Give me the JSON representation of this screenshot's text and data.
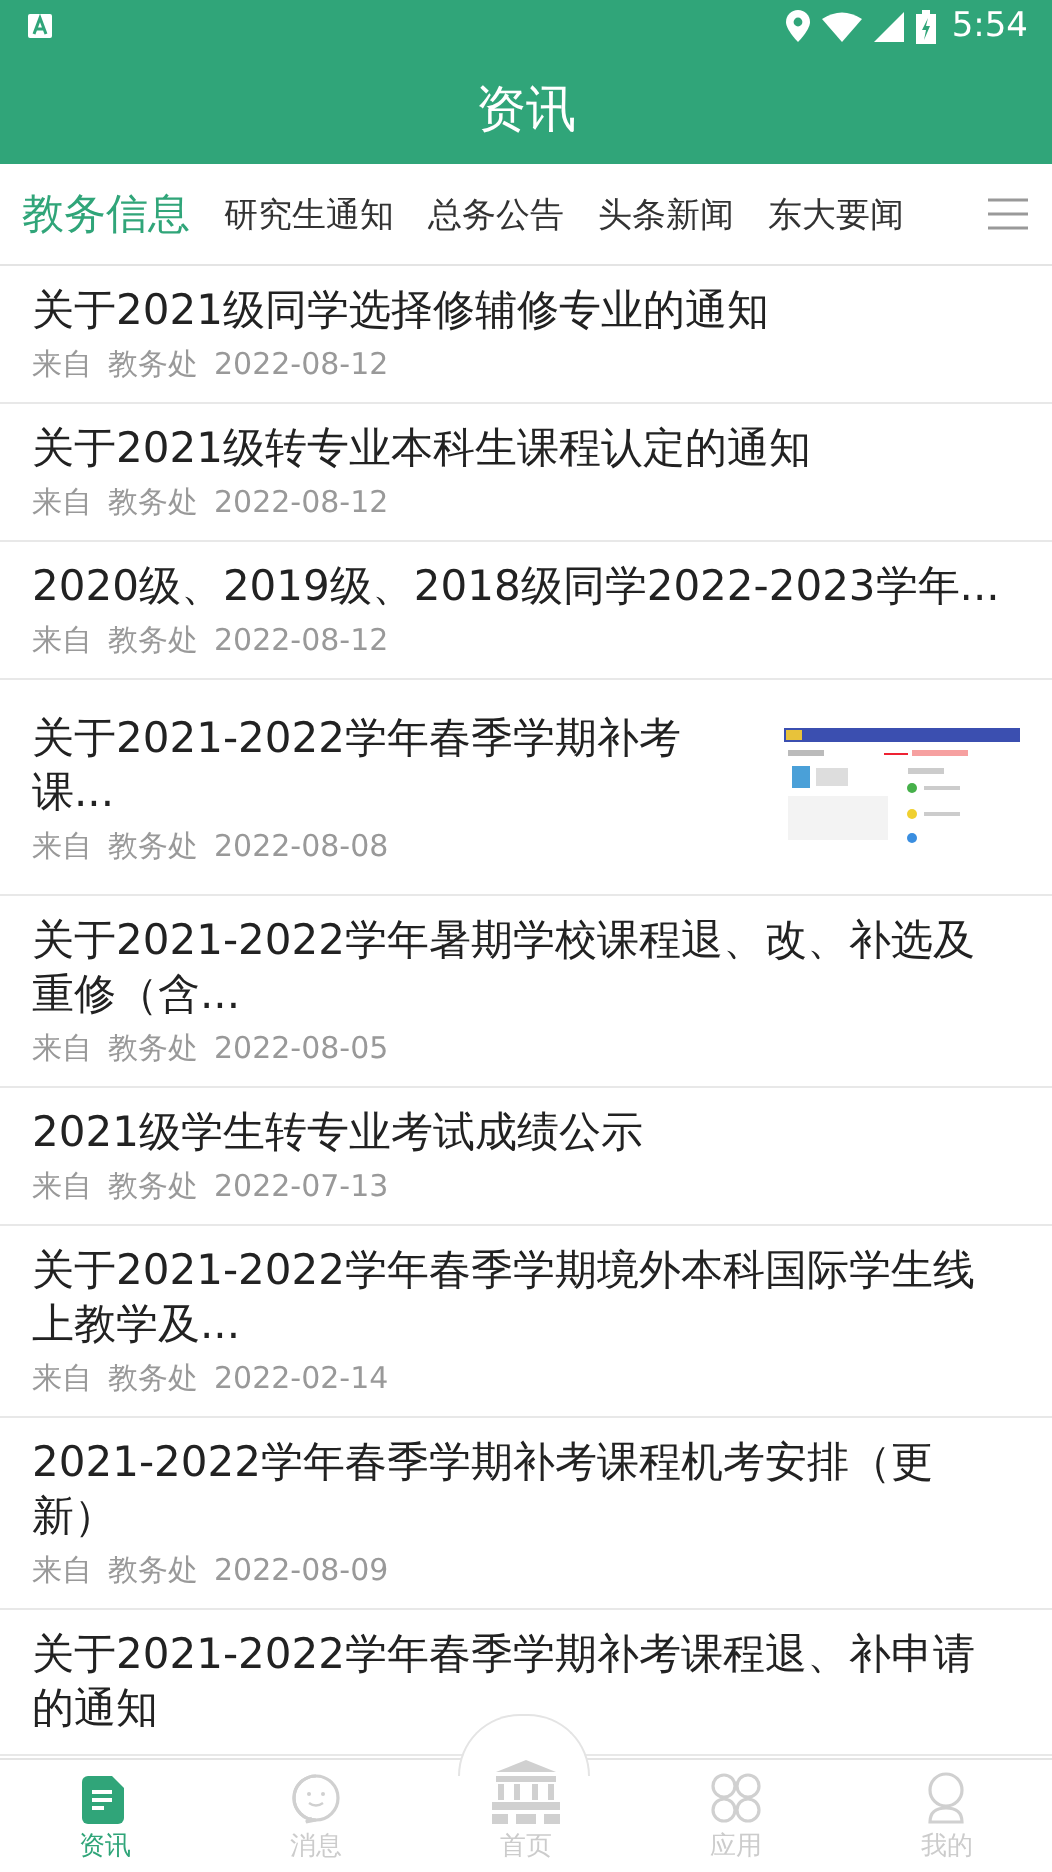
{
  "status_bar": {
    "time": "5:54"
  },
  "header": {
    "title": "资讯"
  },
  "tabs": [
    {
      "label": "教务信息",
      "selected": true
    },
    {
      "label": "研究生通知",
      "selected": false
    },
    {
      "label": "总务公告",
      "selected": false
    },
    {
      "label": "头条新闻",
      "selected": false
    },
    {
      "label": "东大要闻",
      "selected": false
    }
  ],
  "news": [
    {
      "title": "关于2021级同学选择修辅修专业的通知",
      "from_label": "来自",
      "source": "教务处",
      "date": "2022-08-12"
    },
    {
      "title": "关于2021级转专业本科生课程认定的通知",
      "from_label": "来自",
      "source": "教务处",
      "date": "2022-08-12"
    },
    {
      "title": "2020级、2019级、2018级同学2022-2023学年...",
      "from_label": "来自",
      "source": "教务处",
      "date": "2022-08-12"
    },
    {
      "title": "关于2021-2022学年春季学期补考课...",
      "from_label": "来自",
      "source": "教务处",
      "date": "2022-08-08",
      "kind": "picture"
    },
    {
      "title": "关于2021-2022学年暑期学校课程退、改、补选及重修（含...",
      "from_label": "来自",
      "source": "教务处",
      "date": "2022-08-05"
    },
    {
      "title": "2021级学生转专业考试成绩公示",
      "from_label": "来自",
      "source": "教务处",
      "date": "2022-07-13"
    },
    {
      "title": "关于2021-2022学年春季学期境外本科国际学生线上教学及...",
      "from_label": "来自",
      "source": "教务处",
      "date": "2022-02-14"
    },
    {
      "title": "2021-2022学年春季学期补考课程机考安排（更新）",
      "from_label": "来自",
      "source": "教务处",
      "date": "2022-08-09"
    },
    {
      "title": "关于2021-2022学年春季学期补考课程退、补申请的通知"
    }
  ],
  "bottom_nav": [
    {
      "label": "资讯",
      "kind": "news",
      "selected": true
    },
    {
      "label": "消息",
      "kind": "chat",
      "selected": false
    },
    {
      "label": "首页",
      "kind": "home",
      "selected": false
    },
    {
      "label": "应用",
      "kind": "apps",
      "selected": false
    },
    {
      "label": "我的",
      "kind": "profile",
      "selected": false
    }
  ]
}
